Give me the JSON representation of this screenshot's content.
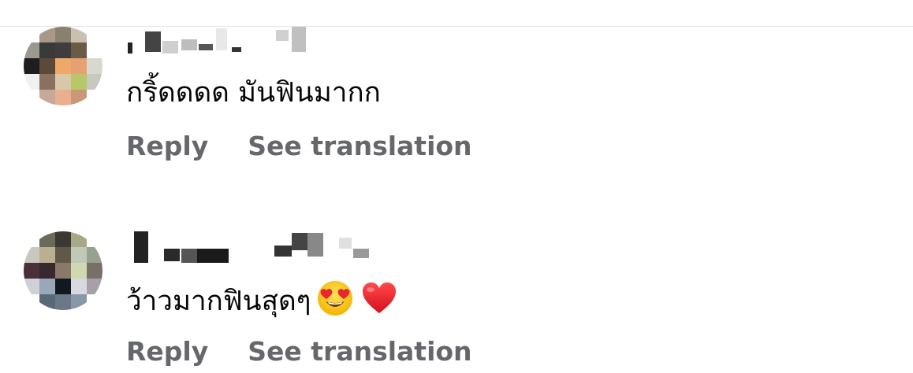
{
  "comments": [
    {
      "text": "กริ้ดดดด มันฟินมากก",
      "reply_label": "Reply",
      "translate_label": "See translation",
      "avatar_colors": [
        "#ffffff",
        "#a89888",
        "#8a8070",
        "#c8c0b0",
        "#ffffff",
        "#9a9890",
        "#3a3a38",
        "#3e3c3c",
        "#6a5a48",
        "#ffffff",
        "#1e1e1e",
        "#5a4a3a",
        "#f0a868",
        "#e8a070",
        "#d8d8d0",
        "#f0f0f0",
        "#8a7060",
        "#d8c8a8",
        "#b8c868",
        "#c8c8c0",
        "#ffffff",
        "#c8a898",
        "#e8b090",
        "#c89878",
        "#ffffff"
      ]
    },
    {
      "text": "ว้าวมากฟินสุดๆ",
      "emojis": [
        "heart-eyes-emoji",
        "red-heart-emoji"
      ],
      "reply_label": "Reply",
      "translate_label": "See translation",
      "avatar_colors": [
        "#ffffff",
        "#6a6a58",
        "#3a3830",
        "#a8a888",
        "#ffffff",
        "#c8c8c0",
        "#b8b090",
        "#605848",
        "#c0c8b8",
        "#98a090",
        "#4a3038",
        "#3a2830",
        "#8a7868",
        "#d0d8b0",
        "#787068",
        "#d0d0d8",
        "#98a8b8",
        "#101820",
        "#d8d8e0",
        "#a8a0a8",
        "#ffffff",
        "#5a6878",
        "#6a7888",
        "#8898a8",
        "#ffffff"
      ]
    }
  ]
}
